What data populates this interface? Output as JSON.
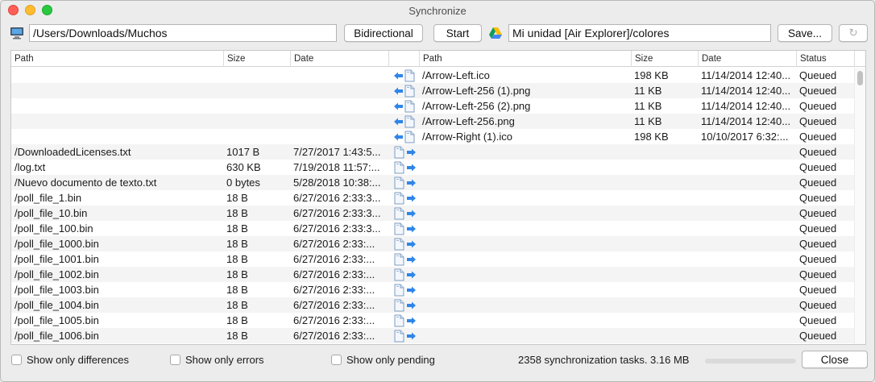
{
  "window": {
    "title": "Synchronize"
  },
  "toolbar": {
    "local_path": "/Users/Downloads/Muchos",
    "direction_label": "Bidirectional",
    "start_label": "Start",
    "remote_path": "Mi unidad [Air Explorer]/colores",
    "save_label": "Save...",
    "refresh_icon": "↻"
  },
  "columns": {
    "left_path": "Path",
    "left_size": "Size",
    "left_date": "Date",
    "right_path": "Path",
    "right_size": "Size",
    "right_date": "Date",
    "status": "Status"
  },
  "rows": [
    {
      "lp": "",
      "ls": "",
      "ld": "",
      "dir": "left",
      "rp": "/Arrow-Left.ico",
      "rs": "198 KB",
      "rd": "11/14/2014 12:40...",
      "st": "Queued"
    },
    {
      "lp": "",
      "ls": "",
      "ld": "",
      "dir": "left",
      "rp": "/Arrow-Left-256 (1).png",
      "rs": "11 KB",
      "rd": "11/14/2014 12:40...",
      "st": "Queued"
    },
    {
      "lp": "",
      "ls": "",
      "ld": "",
      "dir": "left",
      "rp": "/Arrow-Left-256 (2).png",
      "rs": "11 KB",
      "rd": "11/14/2014 12:40...",
      "st": "Queued"
    },
    {
      "lp": "",
      "ls": "",
      "ld": "",
      "dir": "left",
      "rp": "/Arrow-Left-256.png",
      "rs": "11 KB",
      "rd": "11/14/2014 12:40...",
      "st": "Queued"
    },
    {
      "lp": "",
      "ls": "",
      "ld": "",
      "dir": "left",
      "rp": "/Arrow-Right (1).ico",
      "rs": "198 KB",
      "rd": "10/10/2017 6:32:...",
      "st": "Queued"
    },
    {
      "lp": "/DownloadedLicenses.txt",
      "ls": "1017 B",
      "ld": "7/27/2017 1:43:5...",
      "dir": "right",
      "rp": "",
      "rs": "",
      "rd": "",
      "st": "Queued"
    },
    {
      "lp": "/log.txt",
      "ls": "630 KB",
      "ld": "7/19/2018 11:57:...",
      "dir": "right",
      "rp": "",
      "rs": "",
      "rd": "",
      "st": "Queued"
    },
    {
      "lp": "/Nuevo documento de texto.txt",
      "ls": "0 bytes",
      "ld": "5/28/2018 10:38:...",
      "dir": "right",
      "rp": "",
      "rs": "",
      "rd": "",
      "st": "Queued"
    },
    {
      "lp": "/poll_file_1.bin",
      "ls": "18 B",
      "ld": "6/27/2016 2:33:3...",
      "dir": "right",
      "rp": "",
      "rs": "",
      "rd": "",
      "st": "Queued"
    },
    {
      "lp": "/poll_file_10.bin",
      "ls": "18 B",
      "ld": "6/27/2016 2:33:3...",
      "dir": "right",
      "rp": "",
      "rs": "",
      "rd": "",
      "st": "Queued"
    },
    {
      "lp": "/poll_file_100.bin",
      "ls": "18 B",
      "ld": "6/27/2016 2:33:3...",
      "dir": "right",
      "rp": "",
      "rs": "",
      "rd": "",
      "st": "Queued"
    },
    {
      "lp": "/poll_file_1000.bin",
      "ls": "18 B",
      "ld": "6/27/2016 2:33:...",
      "dir": "right",
      "rp": "",
      "rs": "",
      "rd": "",
      "st": "Queued"
    },
    {
      "lp": "/poll_file_1001.bin",
      "ls": "18 B",
      "ld": "6/27/2016 2:33:...",
      "dir": "right",
      "rp": "",
      "rs": "",
      "rd": "",
      "st": "Queued"
    },
    {
      "lp": "/poll_file_1002.bin",
      "ls": "18 B",
      "ld": "6/27/2016 2:33:...",
      "dir": "right",
      "rp": "",
      "rs": "",
      "rd": "",
      "st": "Queued"
    },
    {
      "lp": "/poll_file_1003.bin",
      "ls": "18 B",
      "ld": "6/27/2016 2:33:...",
      "dir": "right",
      "rp": "",
      "rs": "",
      "rd": "",
      "st": "Queued"
    },
    {
      "lp": "/poll_file_1004.bin",
      "ls": "18 B",
      "ld": "6/27/2016 2:33:...",
      "dir": "right",
      "rp": "",
      "rs": "",
      "rd": "",
      "st": "Queued"
    },
    {
      "lp": "/poll_file_1005.bin",
      "ls": "18 B",
      "ld": "6/27/2016 2:33:...",
      "dir": "right",
      "rp": "",
      "rs": "",
      "rd": "",
      "st": "Queued"
    },
    {
      "lp": "/poll_file_1006.bin",
      "ls": "18 B",
      "ld": "6/27/2016 2:33:...",
      "dir": "right",
      "rp": "",
      "rs": "",
      "rd": "",
      "st": "Queued"
    }
  ],
  "footer": {
    "show_differences": "Show only differences",
    "show_errors": "Show only errors",
    "show_pending": "Show only pending",
    "summary": "2358 synchronization tasks. 3.16 MB",
    "progress": 0,
    "close_label": "Close"
  },
  "colors": {
    "accent": "#3b82f6",
    "arrow": "#2f86e8"
  }
}
